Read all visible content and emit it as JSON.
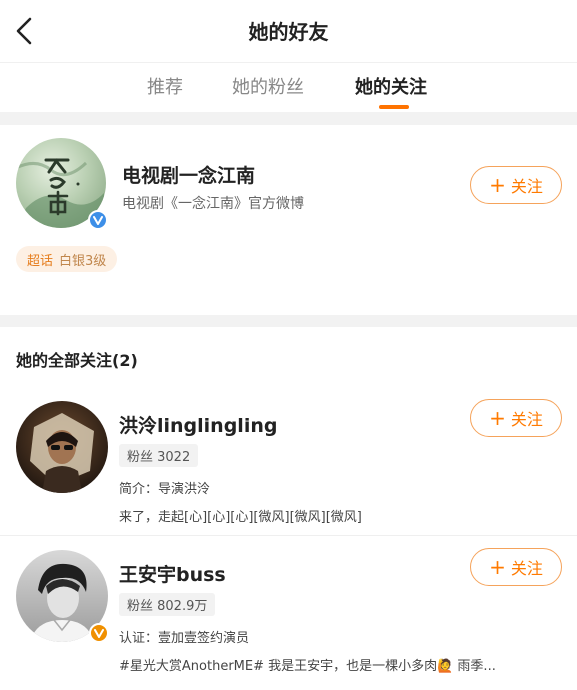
{
  "header": {
    "title": "她的好友",
    "back_icon": "chevron-left-icon"
  },
  "tabs": [
    {
      "label": "推荐",
      "active": false
    },
    {
      "label": "她的粉丝",
      "active": false
    },
    {
      "label": "她的关注",
      "active": true
    }
  ],
  "colors": {
    "accent": "#ff7a00",
    "verified_blue": "#3d8fe8",
    "verified_orange": "#f09000"
  },
  "featured": {
    "name": "电视剧一念江南",
    "desc": "电视剧《一念江南》官方微博",
    "tag": "超话",
    "level": "白银3级",
    "verified": "blue",
    "follow_label": "关注"
  },
  "list": {
    "heading": "她的全部关注(2)",
    "items": [
      {
        "name": "洪泠linglingling",
        "fans": "粉丝 3022",
        "line1": "简介：导演洪泠",
        "line2": "来了，走起[心][心][心][微风][微风][微风]",
        "follow_label": "关注"
      },
      {
        "name": "王安宇buss",
        "fans": "粉丝 802.9万",
        "line1": "认证：壹加壹签约演员",
        "line2": "#星光大赏AnotherME# 我是王安宇，也是一棵小多肉🙋 雨季...",
        "verified": "orange",
        "follow_label": "关注"
      }
    ]
  }
}
